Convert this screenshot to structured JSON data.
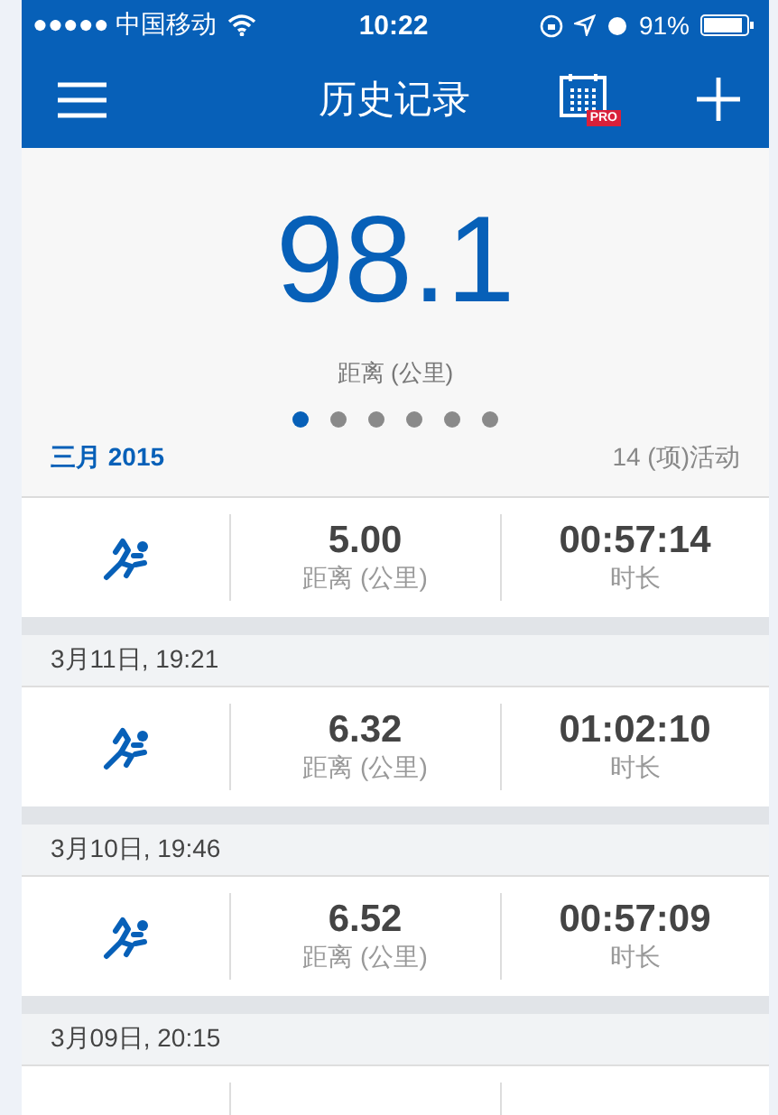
{
  "status_bar": {
    "carrier": "●●●●● 中国移动",
    "time": "10:22",
    "battery": "91%"
  },
  "nav": {
    "title": "历史记录",
    "badge": "PRO"
  },
  "summary": {
    "value": "98.1",
    "label": "距离 (公里)",
    "pages": [
      {
        "selected": true
      },
      {
        "selected": false
      },
      {
        "selected": false
      },
      {
        "selected": false
      },
      {
        "selected": false
      },
      {
        "selected": false
      }
    ]
  },
  "month": {
    "title": "三月 2015",
    "count": "14 (项)活动"
  },
  "activities": [
    {
      "distance": "5.00",
      "distance_label": "距离 (公里)",
      "duration": "00:57:14",
      "duration_label": "时长"
    },
    {
      "date": "3月11日, 19:21",
      "distance": "6.32",
      "distance_label": "距离 (公里)",
      "duration": "01:02:10",
      "duration_label": "时长"
    },
    {
      "date": "3月10日, 19:46",
      "distance": "6.52",
      "distance_label": "距离 (公里)",
      "duration": "00:57:09",
      "duration_label": "时长"
    }
  ],
  "next_date": "3月09日, 20:15"
}
